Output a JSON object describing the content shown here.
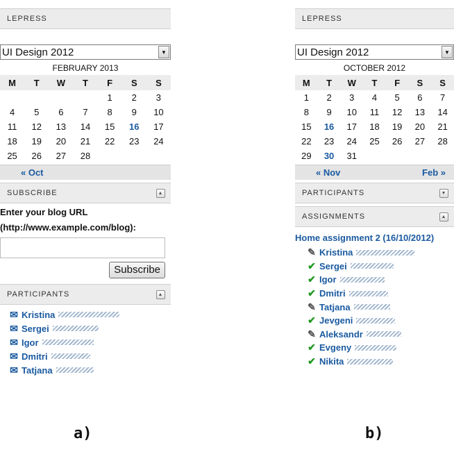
{
  "panel_a": {
    "header_title": "LEPRESS",
    "course_select": "UI Design 2012",
    "calendar": {
      "month": "FEBRUARY 2013",
      "weekdays": [
        "M",
        "T",
        "W",
        "T",
        "F",
        "S",
        "S"
      ],
      "weeks": [
        [
          "",
          "",
          "",
          "",
          "1",
          "2",
          "3"
        ],
        [
          "4",
          "5",
          "6",
          "7",
          "8",
          "9",
          "10"
        ],
        [
          "11",
          "12",
          "13",
          "14",
          "15",
          "16",
          "17"
        ],
        [
          "18",
          "19",
          "20",
          "21",
          "22",
          "23",
          "24"
        ],
        [
          "25",
          "26",
          "27",
          "28",
          "",
          "",
          ""
        ]
      ],
      "prev_link": "« Oct",
      "next_link": ""
    },
    "subscribe": {
      "title": "SUBSCRIBE",
      "label_line1": "Enter your blog URL",
      "label_line2": "(http://www.example.com/blog):",
      "url_value": "",
      "button": "Subscribe"
    },
    "participants": {
      "title": "PARTICIPANTS",
      "items": [
        "Kristina",
        "Sergei",
        "Igor",
        "Dmitri",
        "Tatjana"
      ]
    }
  },
  "panel_b": {
    "header_title": "LEPRESS",
    "course_select": "UI Design 2012",
    "calendar": {
      "month": "OCTOBER 2012",
      "weekdays": [
        "M",
        "T",
        "W",
        "T",
        "F",
        "S",
        "S"
      ],
      "weeks": [
        [
          "1",
          "2",
          "3",
          "4",
          "5",
          "6",
          "7"
        ],
        [
          "8",
          "9",
          "10",
          "11",
          "12",
          "13",
          "14"
        ],
        [
          "15",
          "16",
          "17",
          "18",
          "19",
          "20",
          "21"
        ],
        [
          "22",
          "23",
          "24",
          "25",
          "26",
          "27",
          "28"
        ],
        [
          "29",
          "30",
          "31",
          "",
          "",
          "",
          ""
        ]
      ],
      "prev_link": "« Nov",
      "next_link": "Feb »"
    },
    "participants_title": "PARTICIPANTS",
    "assignments": {
      "title": "ASSIGNMENTS",
      "assignment_title": "Home assignment 2 (16/10/2012)",
      "items": [
        {
          "name": "Kristina",
          "status": "pencil-icon"
        },
        {
          "name": "Sergei",
          "status": "check-icon"
        },
        {
          "name": "Igor",
          "status": "check-icon"
        },
        {
          "name": "Dmitri",
          "status": "check-icon"
        },
        {
          "name": "Tatjana",
          "status": "pencil-icon"
        },
        {
          "name": "Jevgeni",
          "status": "check-icon"
        },
        {
          "name": "Aleksandr",
          "status": "pencil-icon"
        },
        {
          "name": "Evgeny",
          "status": "check-icon"
        },
        {
          "name": "Nikita",
          "status": "check-icon"
        }
      ]
    }
  },
  "captions": {
    "a": "a)",
    "b": "b)"
  },
  "colors": {
    "link": "#1a5aa0",
    "check": "#1f9a20",
    "header_bg": "#ececec"
  }
}
